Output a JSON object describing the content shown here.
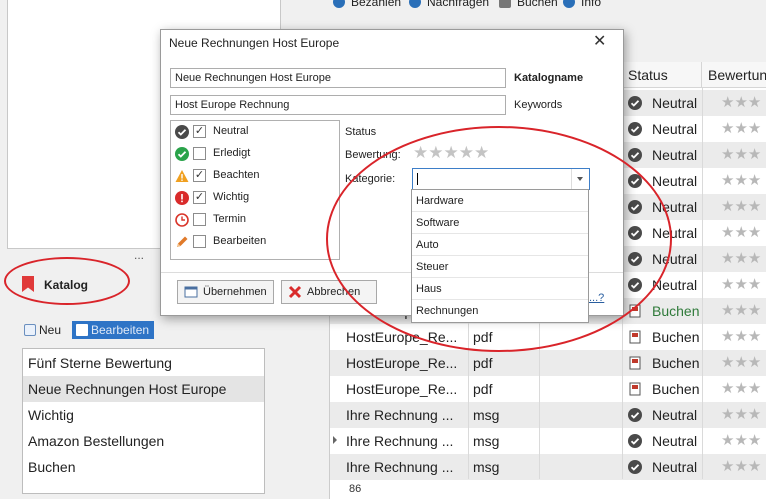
{
  "top_toolbar": {
    "items": [
      {
        "label": "Bezahlen",
        "icon": "euro-icon"
      },
      {
        "label": "Nachfragen",
        "icon": "phone-icon"
      },
      {
        "label": "Buchen",
        "icon": "book-icon"
      },
      {
        "label": "Info",
        "icon": "info-icon"
      }
    ]
  },
  "left": {
    "more_indicator": "...",
    "catalog_label": "Katalog",
    "new_button": "Neu",
    "edit_button": "Bearbeiten",
    "catalog_items": [
      "Fünf Sterne Bewertung",
      "Neue Rechnungen Host Europe",
      "Wichtig",
      "Amazon Bestellungen",
      "Buchen"
    ],
    "selected_index": 1
  },
  "grid": {
    "columns": {
      "status": "Status",
      "rating": "Bewertung"
    },
    "rows": [
      {
        "name": "",
        "type": "",
        "status": "Neutral",
        "status_icon": "neutral-icon"
      },
      {
        "name": "",
        "type": "",
        "status": "Neutral",
        "status_icon": "neutral-icon"
      },
      {
        "name": "",
        "type": "",
        "status": "Neutral",
        "status_icon": "neutral-icon"
      },
      {
        "name": "",
        "type": "",
        "status": "Neutral",
        "status_icon": "neutral-icon"
      },
      {
        "name": "",
        "type": "",
        "status": "Neutral",
        "status_icon": "neutral-icon"
      },
      {
        "name": "",
        "type": "",
        "status": "Neutral",
        "status_icon": "neutral-icon"
      },
      {
        "name": "",
        "type": "",
        "status": "Neutral",
        "status_icon": "neutral-icon"
      },
      {
        "name": "",
        "type": "",
        "status": "Neutral",
        "status_icon": "neutral-icon"
      },
      {
        "name": "HostEuropeRe",
        "type": "",
        "status": "Buchen",
        "status_icon": "book-icon"
      },
      {
        "name": "HostEurope_Re...",
        "type": "pdf",
        "status": "Buchen",
        "status_icon": "book-icon"
      },
      {
        "name": "HostEurope_Re...",
        "type": "pdf",
        "status": "Buchen",
        "status_icon": "book-icon"
      },
      {
        "name": "HostEurope_Re...",
        "type": "pdf",
        "status": "Buchen",
        "status_icon": "book-icon"
      },
      {
        "name": "Ihre Rechnung ...",
        "type": "msg",
        "status": "Neutral",
        "status_icon": "neutral-icon"
      },
      {
        "name": "Ihre Rechnung ...",
        "type": "msg",
        "status": "Neutral",
        "status_icon": "neutral-icon"
      },
      {
        "name": "Ihre Rechnung ...",
        "type": "msg",
        "status": "Neutral",
        "status_icon": "neutral-icon"
      }
    ],
    "footer_count": "86"
  },
  "dialog": {
    "title": "Neue Rechnungen Host Europe",
    "name_value": "Neue Rechnungen Host Europe",
    "name_label": "Katalogname",
    "keywords_value": "Host Europe Rechnung",
    "keywords_label": "Keywords",
    "status_label": "Status",
    "rating_label": "Bewertung:",
    "category_label": "Kategorie:",
    "category_value": "",
    "status_items": [
      {
        "label": "Neutral",
        "checked": true,
        "icon": "neutral-icon"
      },
      {
        "label": "Erledigt",
        "checked": false,
        "icon": "done-icon"
      },
      {
        "label": "Beachten",
        "checked": true,
        "icon": "warning-icon"
      },
      {
        "label": "Wichtig",
        "checked": true,
        "icon": "important-icon"
      },
      {
        "label": "Termin",
        "checked": false,
        "icon": "clock-icon"
      },
      {
        "label": "Bearbeiten",
        "checked": false,
        "icon": "pencil-icon"
      }
    ],
    "apply_button": "Übernehmen",
    "cancel_button": "Abbrechen",
    "help_link": "...?"
  },
  "category_dropdown": {
    "options": [
      "Hardware",
      "Software",
      "Auto",
      "Steuer",
      "Haus",
      "Rechnungen"
    ]
  },
  "colors": {
    "annotation_red": "#d9242a",
    "neutral_icon": "#4a4a4a",
    "done_icon": "#2aa34a",
    "warning_icon": "#f0a020",
    "important_icon": "#d92b2b",
    "accent_blue": "#2a6fb8"
  }
}
